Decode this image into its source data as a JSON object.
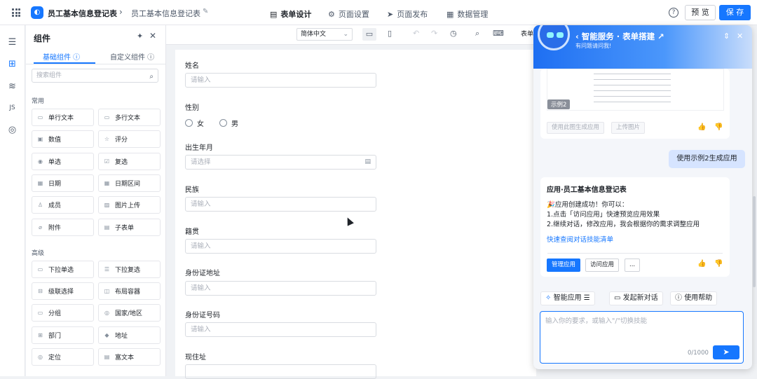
{
  "app": {
    "name": "员工基本信息登记表",
    "breadcrumb": "员工基本信息登记表"
  },
  "top_tabs": [
    {
      "label": "表单设计",
      "icon": "doc-icon"
    },
    {
      "label": "页面设置",
      "icon": "gear-icon"
    },
    {
      "label": "页面发布",
      "icon": "send-icon"
    },
    {
      "label": "数据管理",
      "icon": "table-icon"
    }
  ],
  "top_actions": {
    "help": "?",
    "preview": "预 览",
    "save": "保 存"
  },
  "panel": {
    "title": "组件",
    "tabs": [
      "基础组件",
      "自定义组件"
    ],
    "search_placeholder": "搜索组件",
    "section_common": "常用",
    "section_advanced": "高级",
    "common": [
      "单行文本",
      "多行文本",
      "数值",
      "评分",
      "单选",
      "复选",
      "日期",
      "日期区间",
      "成员",
      "图片上传",
      "附件",
      "子表单"
    ],
    "advanced": [
      "下拉单选",
      "下拉复选",
      "级联选择",
      "布局容器",
      "分组",
      "国家/地区",
      "部门",
      "地址",
      "定位",
      "富文本"
    ]
  },
  "toolbar": {
    "language": "简体中文",
    "partial_label": "表单"
  },
  "form": {
    "fields": [
      {
        "label": "姓名",
        "placeholder": "请输入"
      },
      {
        "label": "性别",
        "options": [
          "女",
          "男"
        ]
      },
      {
        "label": "出生年月",
        "placeholder": "请选择"
      },
      {
        "label": "民族",
        "placeholder": "请输入"
      },
      {
        "label": "籍贯",
        "placeholder": "请输入"
      },
      {
        "label": "身份证地址",
        "placeholder": "请输入"
      },
      {
        "label": "身份证号码",
        "placeholder": "请输入"
      },
      {
        "label": "现住址",
        "placeholder": ""
      }
    ]
  },
  "chat": {
    "title": "智能服务 · 表单搭建",
    "subtitle": "有问题请问我!",
    "example_tag": "示例2",
    "example_buttons": [
      "使用此图生成应用",
      "上传图片"
    ],
    "user_message": "使用示例2生成应用",
    "reply": {
      "title": "应用·员工基本信息登记表",
      "line1": "🎉应用创建成功！你可以：",
      "line2": "1.点击「访问应用」快速预览应用效果",
      "line3": "2.继续对话，修改应用，我会根据你的需求调整应用",
      "link": "快速查阅对话技能清单",
      "buttons": [
        "管理应用",
        "访问应用",
        "..."
      ]
    },
    "actions": [
      "智能应用",
      "发起新对话",
      "使用帮助"
    ],
    "input_placeholder": "输入你的要求，或输入\"/\"切换技能",
    "counter": "0/1000"
  }
}
